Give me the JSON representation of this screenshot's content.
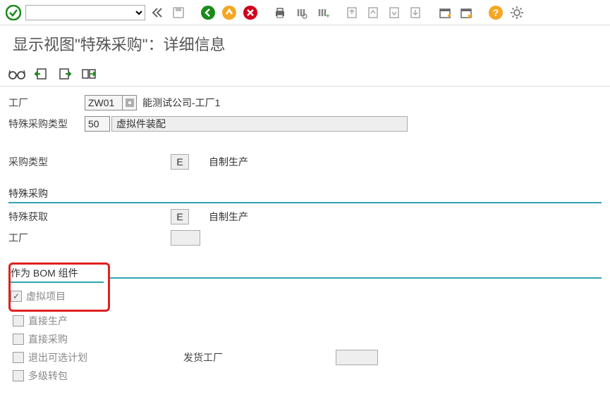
{
  "pageTitle": "显示视图\"特殊采购\"：详细信息",
  "header": {
    "plantLabel": "工厂",
    "plantCode": "ZW01",
    "plantDesc": "能测试公司-工厂1",
    "spTypeLabel": "特殊采购类型",
    "spTypeCode": "50",
    "spTypeDesc": "虚拟件装配"
  },
  "procurement": {
    "label": "采购类型",
    "code": "E",
    "desc": "自制生产"
  },
  "groupSpecial": {
    "title": "特殊采购",
    "spAcqLabel": "特殊获取",
    "spAcqCode": "E",
    "spAcqDesc": "自制生产",
    "plantLabel": "工厂"
  },
  "groupBom": {
    "title": "作为 BOM 组件",
    "phantom": "虚拟项目",
    "directProd": "直接生产",
    "directProc": "直接采购",
    "withdrawAlt": "退出可选计划",
    "shipPlant": "发货工厂",
    "multiSub": "多级转包"
  }
}
